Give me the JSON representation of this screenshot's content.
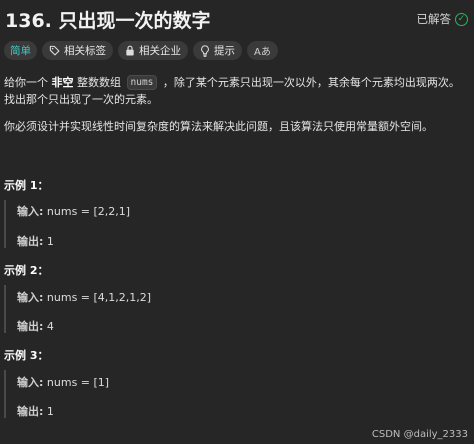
{
  "problem": {
    "title": "136. 只出现一次的数字",
    "status": "已解答"
  },
  "tags": {
    "difficulty": "简单",
    "related_tags": "相关标签",
    "related_companies": "相关企业",
    "hint": "提示",
    "font_toggle": "Aあ"
  },
  "description": {
    "p1_a": "给你一个",
    "p1_bold": "非空",
    "p1_b": "整数数组",
    "p1_code": "nums",
    "p1_c": "，除了某个元素只出现一次以外，其余每个元素均出现两次。找出那个只出现了一次的元素。",
    "p2": "你必须设计并实现线性时间复杂度的算法来解决此问题，且该算法只使用常量额外空间。"
  },
  "examples": [
    {
      "title": "示例 1：",
      "input_label": "输入:",
      "input": "nums = [2,2,1]",
      "output_label": "输出:",
      "output": "1"
    },
    {
      "title": "示例 2：",
      "input_label": "输入:",
      "input": "nums = [4,1,2,1,2]",
      "output_label": "输出:",
      "output": "4"
    },
    {
      "title": "示例 3：",
      "input_label": "输入:",
      "input": "nums = [1]",
      "output_label": "输出:",
      "output": "1"
    }
  ],
  "watermark": "CSDN @daily_2333",
  "icons": {
    "status": "check-circle-icon",
    "related_tags": "tag-icon",
    "related_companies": "lock-icon",
    "hint": "lightbulb-icon",
    "font_toggle": "font-size-icon"
  },
  "colors": {
    "background": "#262626",
    "difficulty_easy": "#46c6c2",
    "solved_green": "#2db55d",
    "tag_background": "#3a3a3a"
  }
}
